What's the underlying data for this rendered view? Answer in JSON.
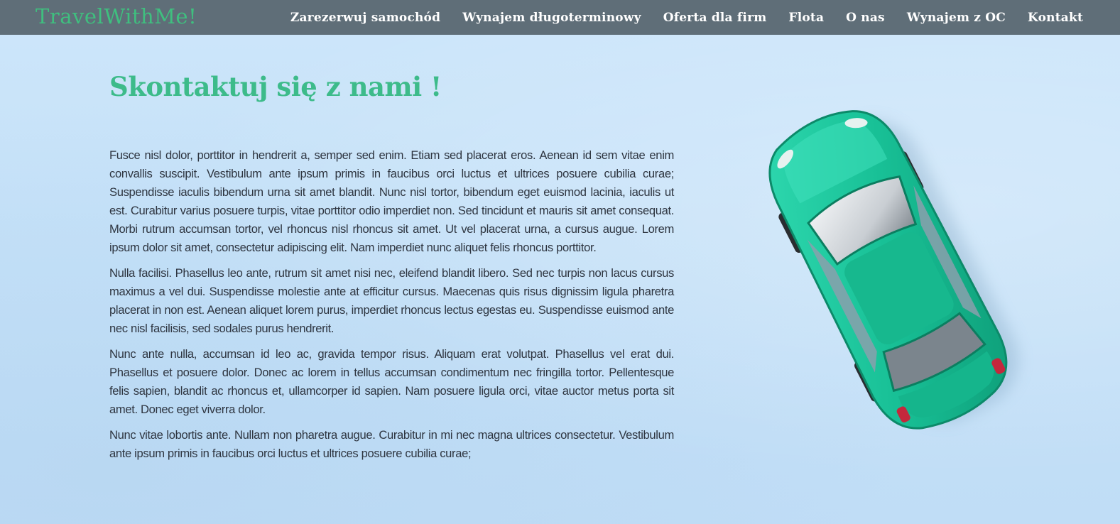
{
  "brand": {
    "name": "TravelWithMe!"
  },
  "nav": {
    "items": [
      {
        "label": "Zarezerwuj samochód"
      },
      {
        "label": "Wynajem długoterminowy"
      },
      {
        "label": "Oferta dla firm"
      },
      {
        "label": "Flota"
      },
      {
        "label": "O nas"
      },
      {
        "label": "Wynajem z OC"
      },
      {
        "label": "Kontakt"
      }
    ]
  },
  "main": {
    "title": "Skontaktuj się z nami !",
    "paragraphs": [
      "Fusce nisl dolor, porttitor in hendrerit a, semper sed enim. Etiam sed placerat eros. Aenean id sem vitae enim convallis suscipit. Vestibulum ante ipsum primis in faucibus orci luctus et ultrices posuere cubilia curae; Suspendisse iaculis bibendum urna sit amet blandit. Nunc nisl tortor, bibendum eget euismod lacinia, iaculis ut est. Curabitur varius posuere turpis, vitae porttitor odio imperdiet non. Sed tincidunt et mauris sit amet consequat. Morbi rutrum accumsan tortor, vel rhoncus nisl rhoncus sit amet. Ut vel placerat urna, a cursus augue. Lorem ipsum dolor sit amet, consectetur adipiscing elit. Nam imperdiet nunc aliquet felis rhoncus porttitor.",
      "Nulla facilisi. Phasellus leo ante, rutrum sit amet nisi nec, eleifend blandit libero. Sed nec turpis non lacus cursus maximus a vel dui. Suspendisse molestie ante at efficitur cursus. Maecenas quis risus dignissim ligula pharetra placerat in non est. Aenean aliquet lorem purus, imperdiet rhoncus lectus egestas eu. Suspendisse euismod ante nec nisl facilisis, sed sodales purus hendrerit.",
      "Nunc ante nulla, accumsan id leo ac, gravida tempor risus. Aliquam erat volutpat. Phasellus vel erat dui. Phasellus et posuere dolor. Donec ac lorem in tellus accumsan condimentum nec fringilla tortor. Pellentesque felis sapien, blandit ac rhoncus et, ullamcorper id sapien. Nam posuere ligula orci, vitae auctor metus porta sit amet. Donec eget viverra dolor.",
      "Nunc vitae lobortis ante. Nullam non pharetra augue. Curabitur in mi nec magna ultrices consectetur. Vestibulum ante ipsum primis in faucibus orci luctus et ultrices posuere cubilia curae;"
    ]
  },
  "colors": {
    "navbar_bg": "#5f6e78",
    "brand": "#3fbf7f",
    "title": "#3dbb8a",
    "page_bg": "#c5e1f8",
    "body_text": "#2e3540",
    "car_body": "#1fc29a"
  },
  "hero_image": {
    "icon": "toy-car-image"
  }
}
